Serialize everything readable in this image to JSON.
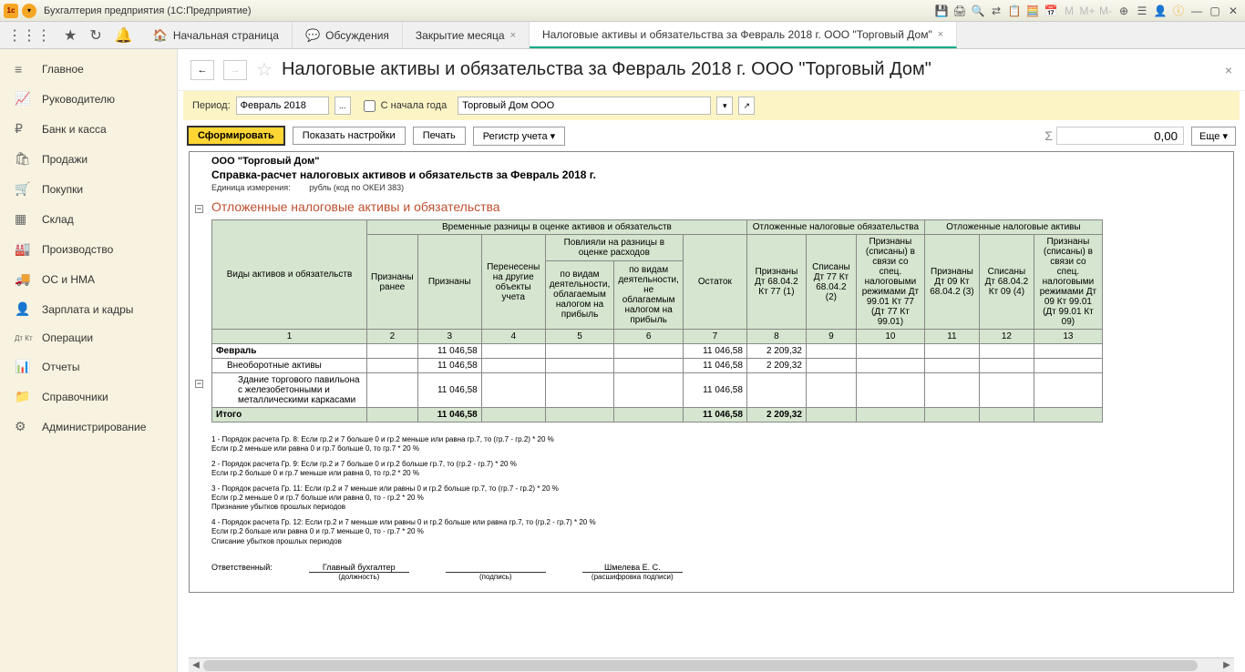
{
  "app": {
    "title": "Бухгалтерия предприятия  (1С:Предприятие)"
  },
  "tabs": {
    "home": "Начальная страница",
    "discuss": "Обсуждения",
    "closing": "Закрытие месяца",
    "active": "Налоговые активы и обязательства за Февраль 2018 г. ООО \"Торговый Дом\""
  },
  "sidebar": {
    "items": [
      {
        "label": "Главное",
        "icon": "≡"
      },
      {
        "label": "Руководителю",
        "icon": "📈"
      },
      {
        "label": "Банк и касса",
        "icon": "₽"
      },
      {
        "label": "Продажи",
        "icon": "🛍"
      },
      {
        "label": "Покупки",
        "icon": "🛒"
      },
      {
        "label": "Склад",
        "icon": "▦"
      },
      {
        "label": "Производство",
        "icon": "🏭"
      },
      {
        "label": "ОС и НМА",
        "icon": "🚚"
      },
      {
        "label": "Зарплата и кадры",
        "icon": "👤"
      },
      {
        "label": "Операции",
        "icon": "Дт Кт"
      },
      {
        "label": "Отчеты",
        "icon": "📊"
      },
      {
        "label": "Справочники",
        "icon": "📁"
      },
      {
        "label": "Администрирование",
        "icon": "⚙"
      }
    ]
  },
  "page": {
    "title": "Налоговые активы и обязательства за Февраль 2018 г. ООО \"Торговый Дом\"",
    "period_label": "Период:",
    "period_value": "Февраль 2018",
    "since_year": "С начала года",
    "org_value": "Торговый Дом ООО",
    "btn_form": "Сформировать",
    "btn_settings": "Показать настройки",
    "btn_print": "Печать",
    "btn_register": "Регистр учета ▾",
    "sum_value": "0,00",
    "btn_more": "Еще ▾"
  },
  "report": {
    "org_name": "ООО \"Торговый Дом\"",
    "title": "Справка-расчет налоговых активов и обязательств за Февраль 2018 г.",
    "unit_label": "Единица измерения:",
    "unit_value": "рубль (код по ОКЕИ 383)",
    "section_title": "Отложенные налоговые активы и обязательства",
    "headers": {
      "col1": "Виды активов и обязательств",
      "grp1": "Временные разницы в оценке активов и обязательств",
      "grp2": "Отложенные налоговые обязательства",
      "grp3": "Отложенные налоговые активы",
      "h2": "Признаны ранее",
      "h3": "Признаны",
      "h4": "Перенесены на другие объекты учета",
      "grp_influence": "Повлияли на разницы в оценке расходов",
      "h5": "по видам деятельности, облагаемым налогом на прибыль",
      "h6": "по видам деятельности, не облагаемым налогом на прибыль",
      "h7": "Остаток",
      "h8": "Признаны Дт 68.04.2 Кт 77 (1)",
      "h9": "Списаны Дт 77 Кт 68.04.2 (2)",
      "h10": "Признаны (списаны) в связи со спец. налоговыми режимами Дт 99.01 Кт 77 (Дт 77 Кт 99.01)",
      "h11": "Признаны Дт 09 Кт 68.04.2 (3)",
      "h12": "Списаны Дт 68.04.2 Кт 09 (4)",
      "h13": "Признаны (списаны) в связи со спец. налоговыми режимами Дт 09 Кт 99.01 (Дт 99.01 Кт 09)"
    },
    "rows": [
      {
        "label": "Февраль",
        "c3": "11 046,58",
        "c7": "11 046,58",
        "c8": "2 209,32",
        "indent": 0,
        "bold": true
      },
      {
        "label": "Внеоборотные активы",
        "c3": "11 046,58",
        "c7": "11 046,58",
        "c8": "2 209,32",
        "indent": 1
      },
      {
        "label": "Здание торгового павильона с железобетонными и металлическими каркасами",
        "c3": "11 046,58",
        "c7": "11 046,58",
        "indent": 2
      }
    ],
    "total": {
      "label": "Итого",
      "c3": "11 046,58",
      "c7": "11 046,58",
      "c8": "2 209,32"
    },
    "footnotes": [
      "1 - Порядок расчета Гр. 8:  Если гр.2 и 7 больше 0 и гр.2 меньше или равна гр.7, то (гр.7 - гр.2) * 20 %\nЕсли гр.2 меньше или равна 0 и гр.7 больше 0, то   гр.7 * 20 %",
      "2 - Порядок расчета Гр. 9:  Если гр.2 и 7 больше 0 и гр.2 больше гр.7, то (гр.2 - гр.7) * 20 %\nЕсли гр.2 больше 0 и гр.7 меньше или равна 0, то   гр.2 * 20 %",
      "3 - Порядок расчета Гр. 11:  Если гр.2 и 7 меньше или равны 0 и гр.2 больше гр.7, то (гр.7 - гр.2) * 20 %\nЕсли гр.2 меньше 0 и гр.7 больше или равна 0, то  - гр.2  * 20 %\nПризнание убытков прошлых периодов",
      "4 - Порядок расчета Гр. 12:  Если гр.2 и 7 меньше или равны 0 и гр.2 больше или равна гр.7, то (гр.2 - гр.7) * 20 %\nЕсли гр.2 больше или равна 0 и гр.7 меньше 0, то  - гр.7 * 20 %\nСписание убытков прошлых периодов"
    ],
    "sig": {
      "responsible": "Ответственный:",
      "position_val": "Главный бухгалтер",
      "position": "(должность)",
      "sign": "(подпись)",
      "name_val": "Шмелева Е. С.",
      "name": "(расшифровка подписи)"
    }
  }
}
